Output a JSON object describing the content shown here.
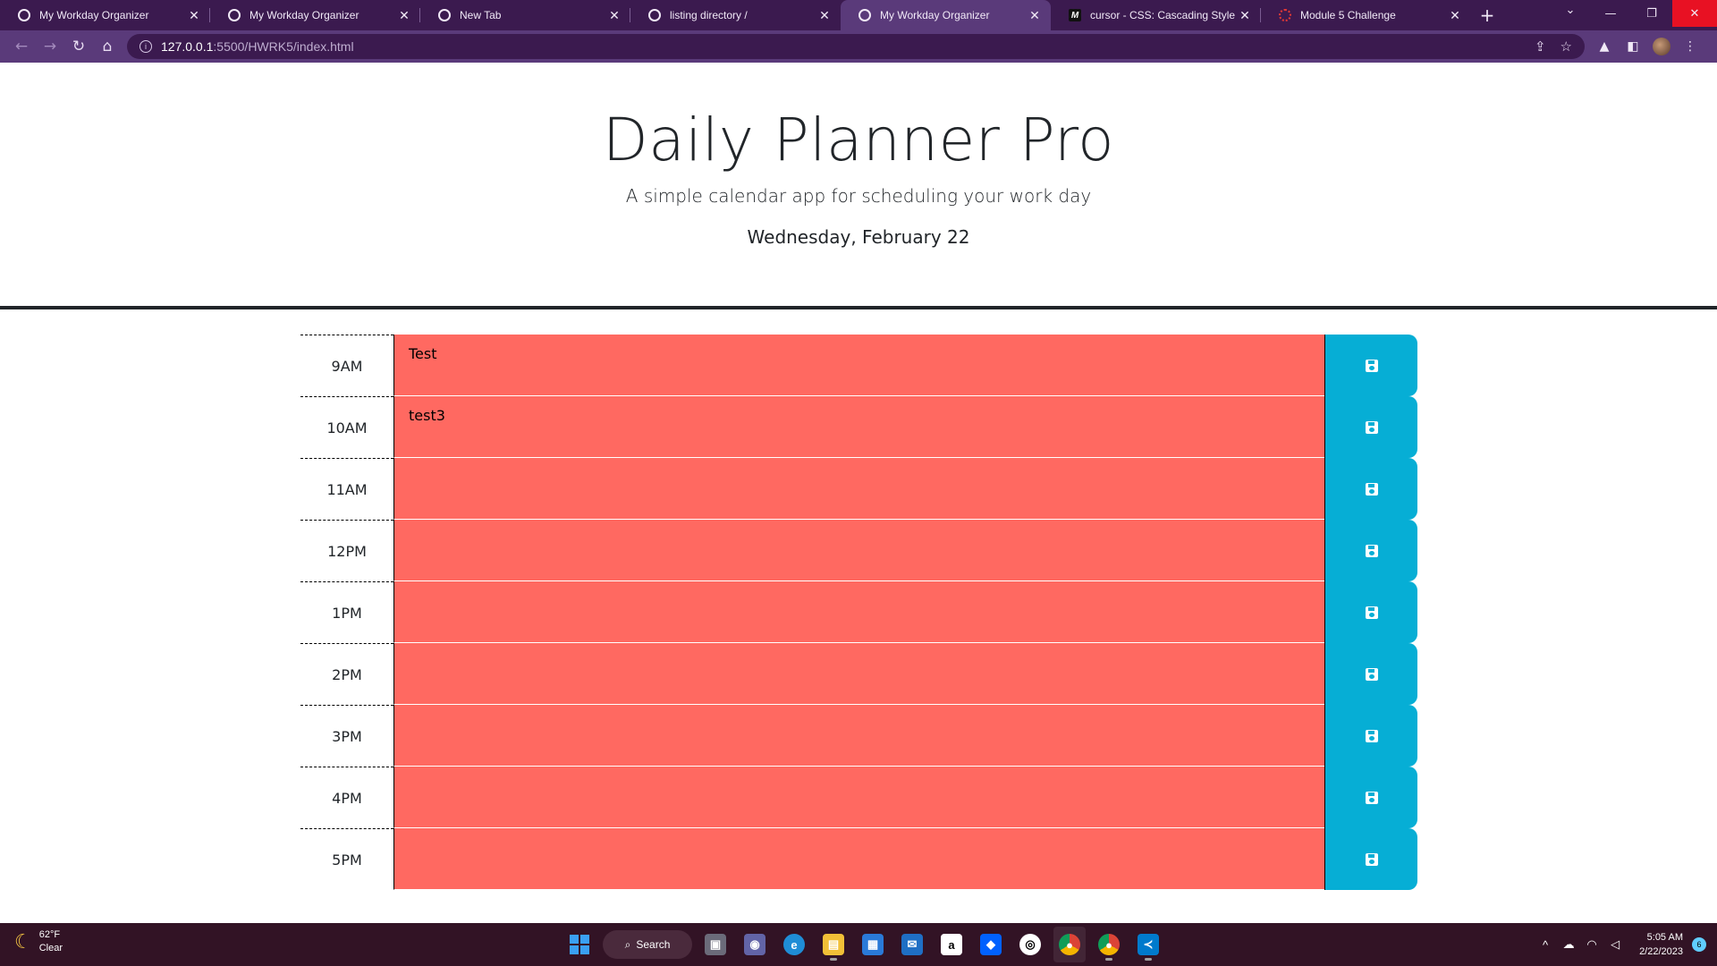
{
  "browser": {
    "tabs": [
      {
        "title": "My Workday Organizer",
        "icon": "globe",
        "active": false
      },
      {
        "title": "My Workday Organizer",
        "icon": "globe",
        "active": false
      },
      {
        "title": "New Tab",
        "icon": "globe",
        "active": false
      },
      {
        "title": "listing directory /",
        "icon": "globe",
        "active": false
      },
      {
        "title": "My Workday Organizer",
        "icon": "globe",
        "active": true
      },
      {
        "title": "cursor - CSS: Cascading Style Sh",
        "icon": "mdn-m",
        "active": false
      },
      {
        "title": "Module 5 Challenge",
        "icon": "loading-ring",
        "active": false
      }
    ],
    "url_host": "127.0.0.1",
    "url_path": ":5500/HWRK5/index.html",
    "close_glyph": "✕",
    "new_tab_glyph": "+"
  },
  "header": {
    "title": "Daily Planner Pro",
    "lead": "A simple calendar app for scheduling your work day",
    "current_day": "Wednesday, February 22"
  },
  "colors": {
    "past": "#ff6961",
    "save": "#06aed5",
    "chrome_dark": "#3b1a4f",
    "chrome_toolbar": "#5a3a7a",
    "taskbar": "#321325"
  },
  "schedule": [
    {
      "hour": "9AM",
      "text": "Test"
    },
    {
      "hour": "10AM",
      "text": "test3"
    },
    {
      "hour": "11AM",
      "text": ""
    },
    {
      "hour": "12PM",
      "text": ""
    },
    {
      "hour": "1PM",
      "text": ""
    },
    {
      "hour": "2PM",
      "text": ""
    },
    {
      "hour": "3PM",
      "text": ""
    },
    {
      "hour": "4PM",
      "text": ""
    },
    {
      "hour": "5PM",
      "text": ""
    }
  ],
  "taskbar": {
    "weather_temp": "62°F",
    "weather_desc": "Clear",
    "search_label": "Search",
    "time": "5:05 AM",
    "date": "2/22/2023",
    "notification_count": "6"
  }
}
